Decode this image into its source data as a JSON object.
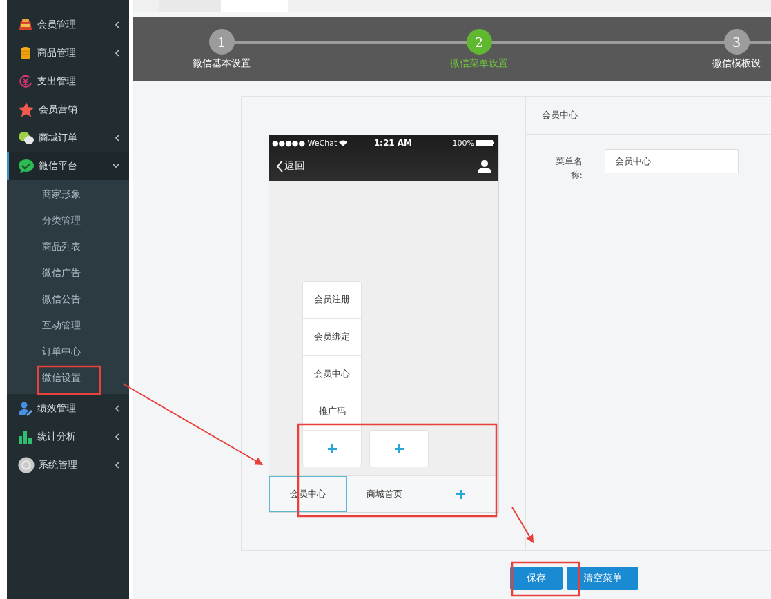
{
  "sidebar": {
    "items": [
      {
        "label": "会员管理",
        "kind": "submenu",
        "expanded": false,
        "selected": false
      },
      {
        "label": "商品管理",
        "kind": "submenu",
        "expanded": false,
        "selected": false
      },
      {
        "label": "支出管理",
        "kind": "link",
        "selected": false
      },
      {
        "label": "会员营销",
        "kind": "link",
        "selected": false
      },
      {
        "label": "商城订单",
        "kind": "submenu",
        "expanded": false,
        "selected": false
      },
      {
        "label": "微信平台",
        "kind": "submenu",
        "expanded": true,
        "selected": true,
        "children": [
          "商家形象",
          "分类管理",
          "商品列表",
          "微信广告",
          "微信公告",
          "互动管理",
          "订单中心",
          "微信设置"
        ]
      },
      {
        "label": "绩效管理",
        "kind": "submenu",
        "expanded": false,
        "selected": false
      },
      {
        "label": "统计分析",
        "kind": "submenu",
        "expanded": false,
        "selected": false
      },
      {
        "label": "系统管理",
        "kind": "submenu",
        "expanded": false,
        "selected": false
      }
    ]
  },
  "steps": [
    {
      "number": "1",
      "label": "微信基本设置",
      "selected": false
    },
    {
      "number": "2",
      "label": "微信菜单设置",
      "selected": true
    },
    {
      "number": "3",
      "label": "微信模板设",
      "selected": false
    }
  ],
  "phone": {
    "status_bar": {
      "carrier": "●●●●● WeChat",
      "time": "1:21 AM",
      "battery": "100%"
    },
    "back": "返回",
    "menus": [
      {
        "label": "会员中心",
        "selected": true,
        "submenu": [
          "会员注册",
          "会员绑定",
          "会员中心",
          "推广码"
        ]
      },
      {
        "label": "商城首页",
        "selected": false
      }
    ]
  },
  "editor": {
    "title": "会员中心",
    "field_label": "菜单名称:",
    "field_value": "会员中心"
  },
  "buttons": [
    "保存",
    "清空菜单"
  ]
}
